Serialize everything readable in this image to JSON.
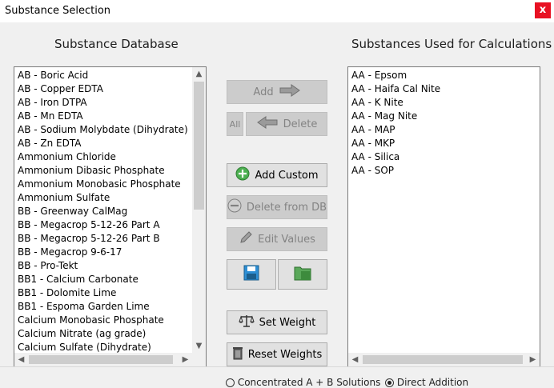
{
  "window": {
    "title": "Substance Selection",
    "close_label": "x"
  },
  "left_panel": {
    "heading": "Substance Database",
    "items": [
      "AB - Boric Acid",
      "AB - Copper EDTA",
      "AB - Iron DTPA",
      "AB - Mn EDTA",
      "AB - Sodium Molybdate (Dihydrate)",
      "AB - Zn EDTA",
      "Ammonium Chloride",
      "Ammonium Dibasic Phosphate",
      "Ammonium Monobasic Phosphate",
      "Ammonium Sulfate",
      "BB - Greenway CalMag",
      "BB - Megacrop 5-12-26 Part A",
      "BB - Megacrop 5-12-26 Part B",
      "BB - Megacrop 9-6-17",
      "BB - Pro-Tekt",
      "BB1 - Calcium Carbonate",
      "BB1 - Dolomite Lime",
      "BB1 - Espoma Garden Lime",
      "Calcium Monobasic Phosphate",
      "Calcium Nitrate (ag grade)",
      "Calcium Sulfate (Dihydrate)"
    ]
  },
  "right_panel": {
    "heading": "Substances Used for Calculations",
    "items": [
      "AA - Epsom",
      "AA - Haifa Cal Nite",
      "AA - K Nite",
      "AA - Mag Nite",
      "AA - MAP",
      "AA - MKP",
      "AA - Silica",
      "AA - SOP"
    ]
  },
  "buttons": {
    "add": "Add",
    "all": "All",
    "delete": "Delete",
    "add_custom": "Add Custom",
    "delete_from_db": "Delete from DB",
    "edit_values": "Edit Values",
    "set_weight": "Set Weight",
    "reset_weights": "Reset Weights"
  },
  "bottom_options": {
    "option1": "Concentrated A + B Solutions",
    "option2": "Direct Addition",
    "selected": "Direct Addition"
  },
  "colors": {
    "close_bg": "#e81123",
    "disabled_button": "#cccccc",
    "green_plus": "#4caf50",
    "folder_green": "#5aa85a"
  }
}
